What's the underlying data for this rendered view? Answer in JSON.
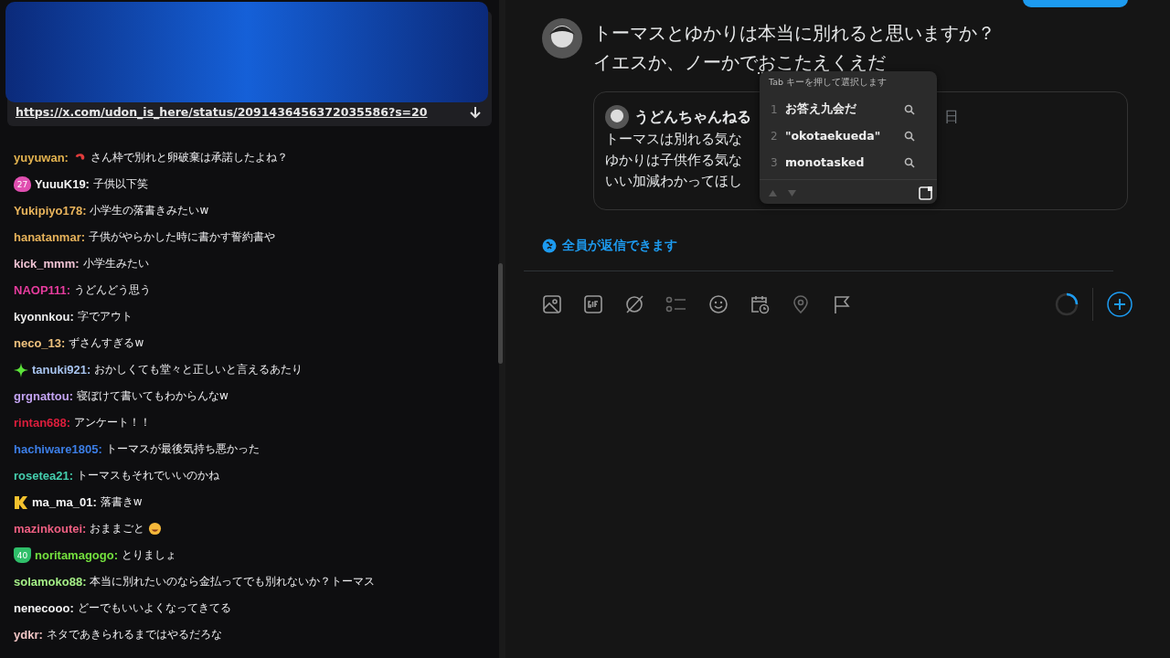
{
  "chat": {
    "pinned": {
      "link": "https://x.com/udon_is_here/status/2091436456372035586?s=20"
    },
    "messages": [
      {
        "user": "yuyuwan:",
        "color": "#e2b24f",
        "text": "さん枠で別れと卵破棄は承諾したよね？",
        "emoji": {
          "kind": "before"
        }
      },
      {
        "user": "YuuuK19:",
        "color": "#f2f2f2",
        "text": "子供以下笑",
        "badge": {
          "kind": "sub",
          "label": "27"
        }
      },
      {
        "user": "Yukipiyo178:",
        "color": "#e9b45c",
        "text": "小学生の落書きみたいw"
      },
      {
        "user": "hanatanmar:",
        "color": "#e6b25a",
        "text": "子供がやらかした時に書かす誓約書や"
      },
      {
        "user": "kick_mmm:",
        "color": "#f0c3d4",
        "text": "小学生みたい"
      },
      {
        "user": "NAOP111:",
        "color": "#e63c9e",
        "text": "うどんどう思う"
      },
      {
        "user": "kyonnkou:",
        "color": "#ececec",
        "text": "字でアウト"
      },
      {
        "user": "neco_13:",
        "color": "#efc27e",
        "text": "ずさんすぎるw"
      },
      {
        "user": "tanuki921:",
        "color": "#a8c4ef",
        "text": "おかしくても堂々と正しいと言えるあたり",
        "badge": {
          "kind": "sparkle"
        }
      },
      {
        "user": "grgnattou:",
        "color": "#c3a3f2",
        "text": "寝ぼけて書いてもわからんなw"
      },
      {
        "user": "rintan688:",
        "color": "#dc1e3c",
        "text": "アンケート！！"
      },
      {
        "user": "hachiware1805:",
        "color": "#3c7ee6",
        "text": "トーマスが最後気持ち悪かった"
      },
      {
        "user": "rosetea21:",
        "color": "#45cfae",
        "text": "トーマスもそれでいいのかね"
      },
      {
        "user": "ma_ma_01:",
        "color": "#f4f4f4",
        "text": "落書きw",
        "badge": {
          "kind": "k"
        }
      },
      {
        "user": "mazinkoutei:",
        "color": "#ee5f82",
        "text": "おままごと",
        "emoji": {
          "kind": "after"
        }
      },
      {
        "user": "noritamagogo:",
        "color": "#74e03e",
        "text": "とりましょ",
        "badge": {
          "kind": "shield",
          "label": "40"
        }
      },
      {
        "user": "solamoko88:",
        "color": "#a4ee86",
        "text": "本当に別れたいのなら金払ってでも別れないか？トーマス"
      },
      {
        "user": "nenecooo:",
        "color": "#f2f2f2",
        "text": "どーでもいいよくなってきてる"
      },
      {
        "user": "ydkr:",
        "color": "#f0c4c4",
        "text": "ネタであきられるまではやるだろな"
      }
    ]
  },
  "compose": {
    "lines": [
      [
        {
          "text": "トーマスとゆかりは本当に別れると思いますか？",
          "composing": false
        }
      ],
      [
        {
          "text": "イエスか、ノーかで",
          "composing": false
        },
        {
          "text": "おこたえくえだ",
          "composing": true
        }
      ]
    ],
    "quote": {
      "author": "うどんちゃんねる",
      "date": "日",
      "lines": [
        "トーマスは別れる気な",
        "ゆかりは子供作る気な",
        "いい加減わかってほし"
      ]
    },
    "ime": {
      "hint": "Tab キーを押して選択します",
      "candidates": [
        {
          "number": "1",
          "text": "お答え九会だ"
        },
        {
          "number": "2",
          "text": "\"okotaekueda\""
        },
        {
          "number": "3",
          "text": "monotasked"
        }
      ]
    },
    "reply_setting": "全員が返信できます",
    "toolbar": [
      {
        "kind": "image"
      },
      {
        "kind": "gif"
      },
      {
        "kind": "slash"
      },
      {
        "kind": "list"
      },
      {
        "kind": "smiley"
      },
      {
        "kind": "calendar"
      },
      {
        "kind": "pin"
      },
      {
        "kind": "flag"
      }
    ]
  }
}
